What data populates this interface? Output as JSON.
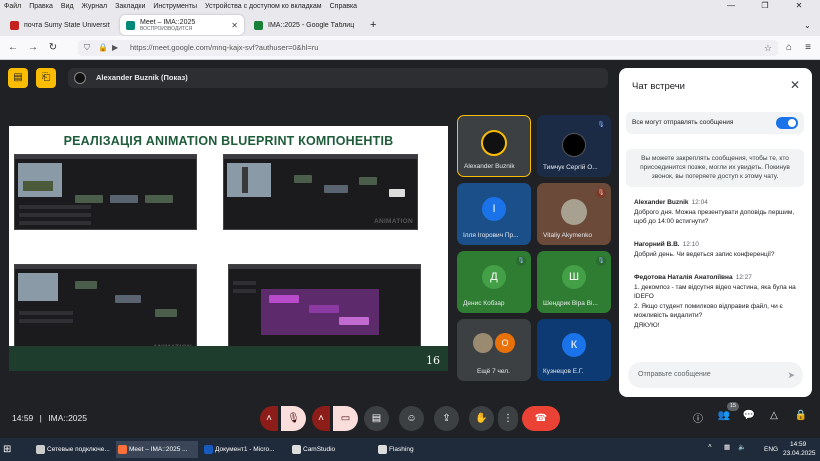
{
  "menu": [
    "Файл",
    "Правка",
    "Вид",
    "Журнал",
    "Закладки",
    "Инструменты",
    "Устройства с доступом ко вкладкам",
    "Справка"
  ],
  "browser": {
    "tabs": [
      {
        "title": "почта Sumy State University",
        "sub": ""
      },
      {
        "title": "Meet – IMA::2025",
        "sub": "ВОСПРОИЗВОДИТСЯ"
      },
      {
        "title": "IMA::2025 - Google Таблицы",
        "sub": ""
      }
    ],
    "new_tab": "+",
    "url": "https://meet.google.com/mnq-kajx-svf?authuser=0&hl=ru"
  },
  "meet": {
    "presenter": "Alexander Buznik (Показ)",
    "slide": {
      "title": "РЕАЛІЗАЦІЯ ANIMATION BLUEPRINT КОМПОНЕНТІВ",
      "watermark": "ANIMATION",
      "page": "16"
    },
    "tiles": [
      {
        "name": "Alexander Buznik",
        "initial": "",
        "color": "#3c4043",
        "muted": false
      },
      {
        "name": "Тимчук Сергій О...",
        "initial": "",
        "color": "#1c2b45",
        "muted": true
      },
      {
        "name": "Ілля Ігорович Пр...",
        "initial": "І",
        "color": "#1a73e8",
        "muted": false
      },
      {
        "name": "Vitaliy Akymenko",
        "initial": "",
        "color": "#5c4a3f",
        "muted": true
      },
      {
        "name": "Денис Кобзар",
        "initial": "Д",
        "color": "#34a853",
        "muted": true
      },
      {
        "name": "Шендрик Віра Ві...",
        "initial": "Ш",
        "color": "#43a047",
        "muted": true
      },
      {
        "name": "Ещё 7 чел.",
        "initial": "О",
        "color": "#e8710a",
        "muted": false
      },
      {
        "name": "Кузнецов Е.Г.",
        "initial": "К",
        "color": "#1a73e8",
        "muted": false
      }
    ],
    "clock": "14:59",
    "meeting_code": "IMA::2025",
    "participants_count": "15"
  },
  "chat": {
    "title": "Чат встречи",
    "toggle_label": "Все могут отправлять сообщения",
    "info": "Вы можете закреплять сообщения, чтобы те, кто присоединится позже, могли их увидеть. Покинув звонок, вы потеряете доступ к этому чату.",
    "messages": [
      {
        "author": "Alexander Buznik",
        "time": "12:04",
        "text": "Доброго дня. Можна презентувати доповідь першим, щоб до 14:00 встигнути?"
      },
      {
        "author": "Нагорний В.В.",
        "time": "12:10",
        "text": "Добрий день. Чи ведеться запис конференції?"
      },
      {
        "author": "Федотова Наталія Анатоліївна",
        "time": "12:27",
        "lines": [
          "1. декомпоз - там відсутня відео частина, яка була на IDEFO",
          "2. Якщо студент помилково відправив файл, чи є можливість видалити?",
          "ДЯКУЮ!"
        ]
      }
    ],
    "input_placeholder": "Отправьте сообщение"
  },
  "taskbar": {
    "items": [
      "Сетевые подключе...",
      "Meet – IMA::2025 ...",
      "Документ1 - Micro...",
      "CamStudio",
      "Flashing"
    ],
    "lang": "ENG",
    "time": "14:59",
    "date": "23.04.2025"
  },
  "colors": {
    "accent": "#1a73e8",
    "danger": "#ea4335",
    "presenter_btn": "#fbbc04"
  }
}
